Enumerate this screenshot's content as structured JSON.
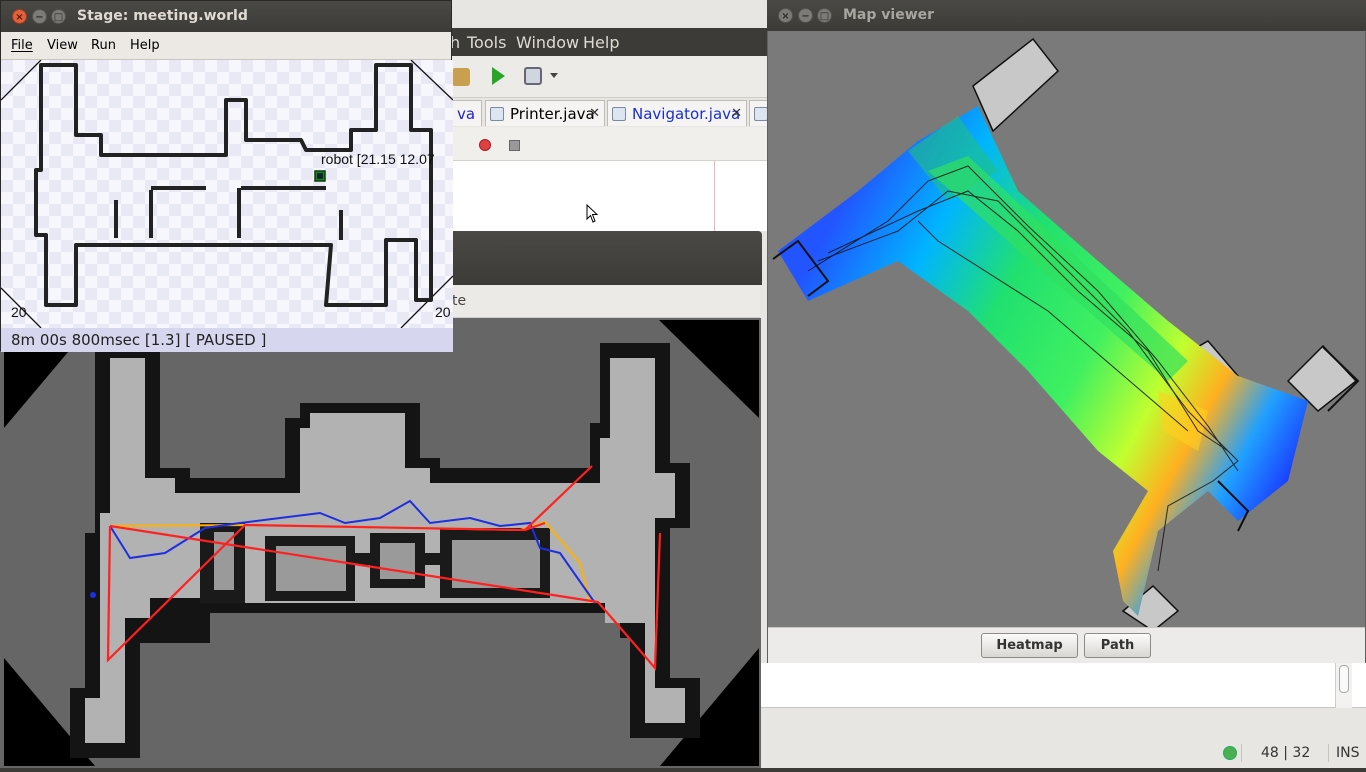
{
  "stage_window": {
    "title": "Stage: meeting.world",
    "menu": [
      "File",
      "View",
      "Run",
      "Help"
    ],
    "robot_label": "robot [21.15 12.07",
    "corner_label_left": "20",
    "corner_label_right": "20",
    "status": "8m 00s 800msec [1.3]  [ PAUSED ]"
  },
  "ide": {
    "menu": {
      "partial": "h",
      "tools": "Tools",
      "window": "Window",
      "help": "Help"
    },
    "tabs": [
      {
        "label": "va",
        "close": "✕"
      },
      {
        "label": "Printer.java",
        "close": "✕"
      },
      {
        "label": "Navigator.java",
        "close": "✕"
      }
    ],
    "partial_label": "te",
    "status": {
      "position": "48 | 32",
      "mode": "INS"
    }
  },
  "map_viewer": {
    "title": "Map viewer",
    "buttons": [
      "Heatmap",
      "Path"
    ]
  },
  "colors": {
    "accent_red": "#ff2020",
    "path_blue": "#1d2fe0",
    "path_orange": "#ffb000",
    "title_bar": "#3c3b37"
  }
}
